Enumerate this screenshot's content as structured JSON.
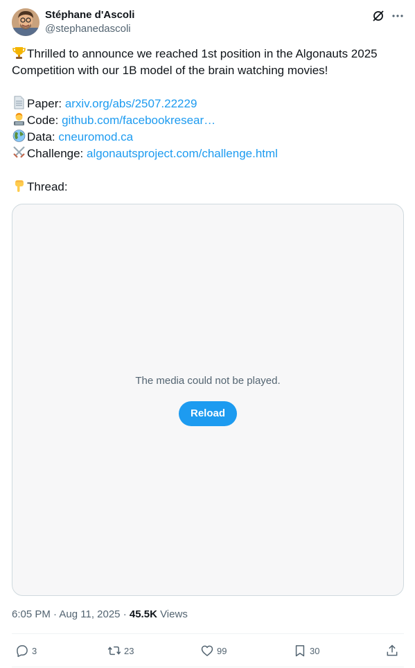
{
  "author": {
    "name": "Stéphane d'Ascoli",
    "handle": "@stephanedascoli"
  },
  "tweet": {
    "line1": "Thrilled to announce we reached 1st position in the Algonauts 2025",
    "line2": "Competition with our 1B model of the brain watching movies!",
    "paper_label": "Paper: ",
    "paper_link": "arxiv.org/abs/2507.22229",
    "code_label": "Code: ",
    "code_link": "github.com/facebookresear…",
    "data_label": "Data: ",
    "data_link": "cneuromod.ca",
    "challenge_label": "Challenge: ",
    "challenge_link": "algonautsproject.com/challenge.html",
    "thread_label": "Thread:"
  },
  "media": {
    "error_message": "The media could not be played.",
    "reload_label": "Reload"
  },
  "meta": {
    "time": "6:05 PM",
    "date": "Aug 11, 2025",
    "views_count": "45.5K",
    "views_label": "Views"
  },
  "actions": {
    "replies": "3",
    "reposts": "23",
    "likes": "99",
    "bookmarks": "30"
  },
  "icons": {
    "avatar": "avatar-photo",
    "grok": "grok-icon",
    "more": "more-icon",
    "trophy": "trophy-emoji",
    "paper": "page-emoji",
    "code": "technologist-emoji",
    "data": "globe-emoji",
    "challenge": "crossed-swords-emoji",
    "thread": "pointing-down-emoji",
    "reply": "reply-icon",
    "repost": "repost-icon",
    "like": "heart-icon",
    "bookmark": "bookmark-icon",
    "share": "share-icon"
  },
  "colors": {
    "link": "#1d9bf0",
    "secondary_text": "#536471",
    "primary_text": "#0f1419",
    "reload_button": "#1d9bf0"
  }
}
